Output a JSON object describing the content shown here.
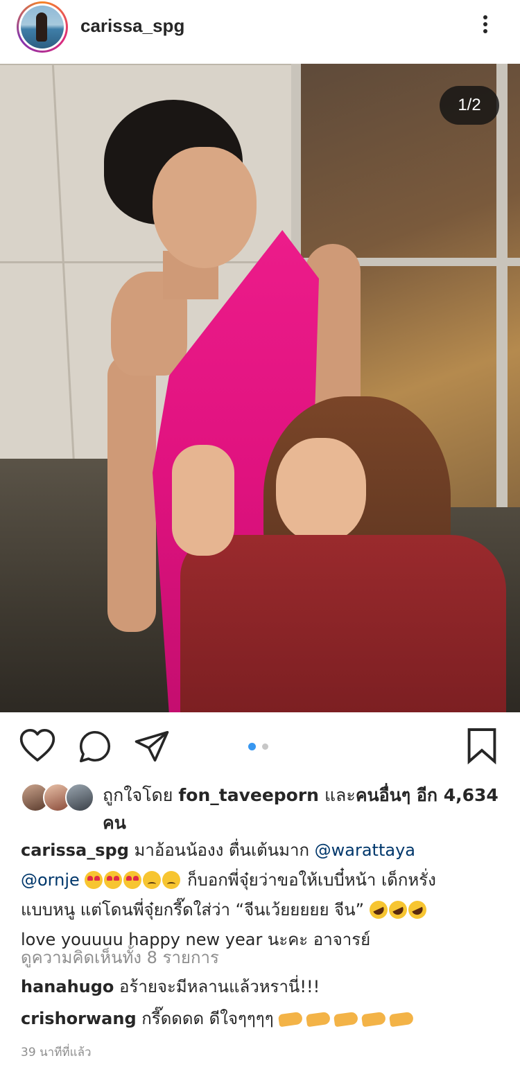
{
  "header": {
    "username": "carissa_spg",
    "avatar": "profile-avatar",
    "more_icon": "more-vertical-icon"
  },
  "photo": {
    "counter": "1/2",
    "description_icon": "post-photo"
  },
  "actions": {
    "icons": [
      "heart-icon",
      "comment-icon",
      "share-icon",
      "bookmark-icon"
    ],
    "carousel_dots": {
      "count": 2,
      "active_index": 0,
      "active_color": "#3897f0",
      "inactive_color": "#c7c7c7"
    }
  },
  "likes": {
    "prefix": "ถูกใจโดย",
    "user": "fon_taveeporn",
    "connector": "และ",
    "others": "คนอื่นๆ อีก 4,634",
    "suffix": "คน"
  },
  "caption": {
    "username": "carissa_spg",
    "text1": "มาอ้อนน้องง ตื่นเต้นมาก",
    "mention1": "@warattaya",
    "mention2": "@ornje",
    "text2": "ก็บอกพี่จุ๋ยว่าขอให้เบบี๋หน้า เด็กหรั่ง",
    "text3": "แบบหนู แต่โดนพี่จุ๋ยกรี๊ดใส่ว่า “จีนเว้ยยยยย จีน”",
    "text4": "love youuuu happy new year นะคะ อาจารย์"
  },
  "comments": {
    "view_all": "ดูความคิดเห็นทั้ง 8 รายการ",
    "items": [
      {
        "username": "hanahugo",
        "text": "อร้ายจะมีหลานแล้วหรานี่!!!"
      },
      {
        "username": "crishorwang",
        "text": "กรี๊ดดดด ดีใจๆๆๆๆ"
      }
    ]
  },
  "timestamp": "39 นาทีที่แล้ว",
  "colors": {
    "mention": "#00376b",
    "secondary_text": "#8e8e8e",
    "text": "#262626"
  }
}
